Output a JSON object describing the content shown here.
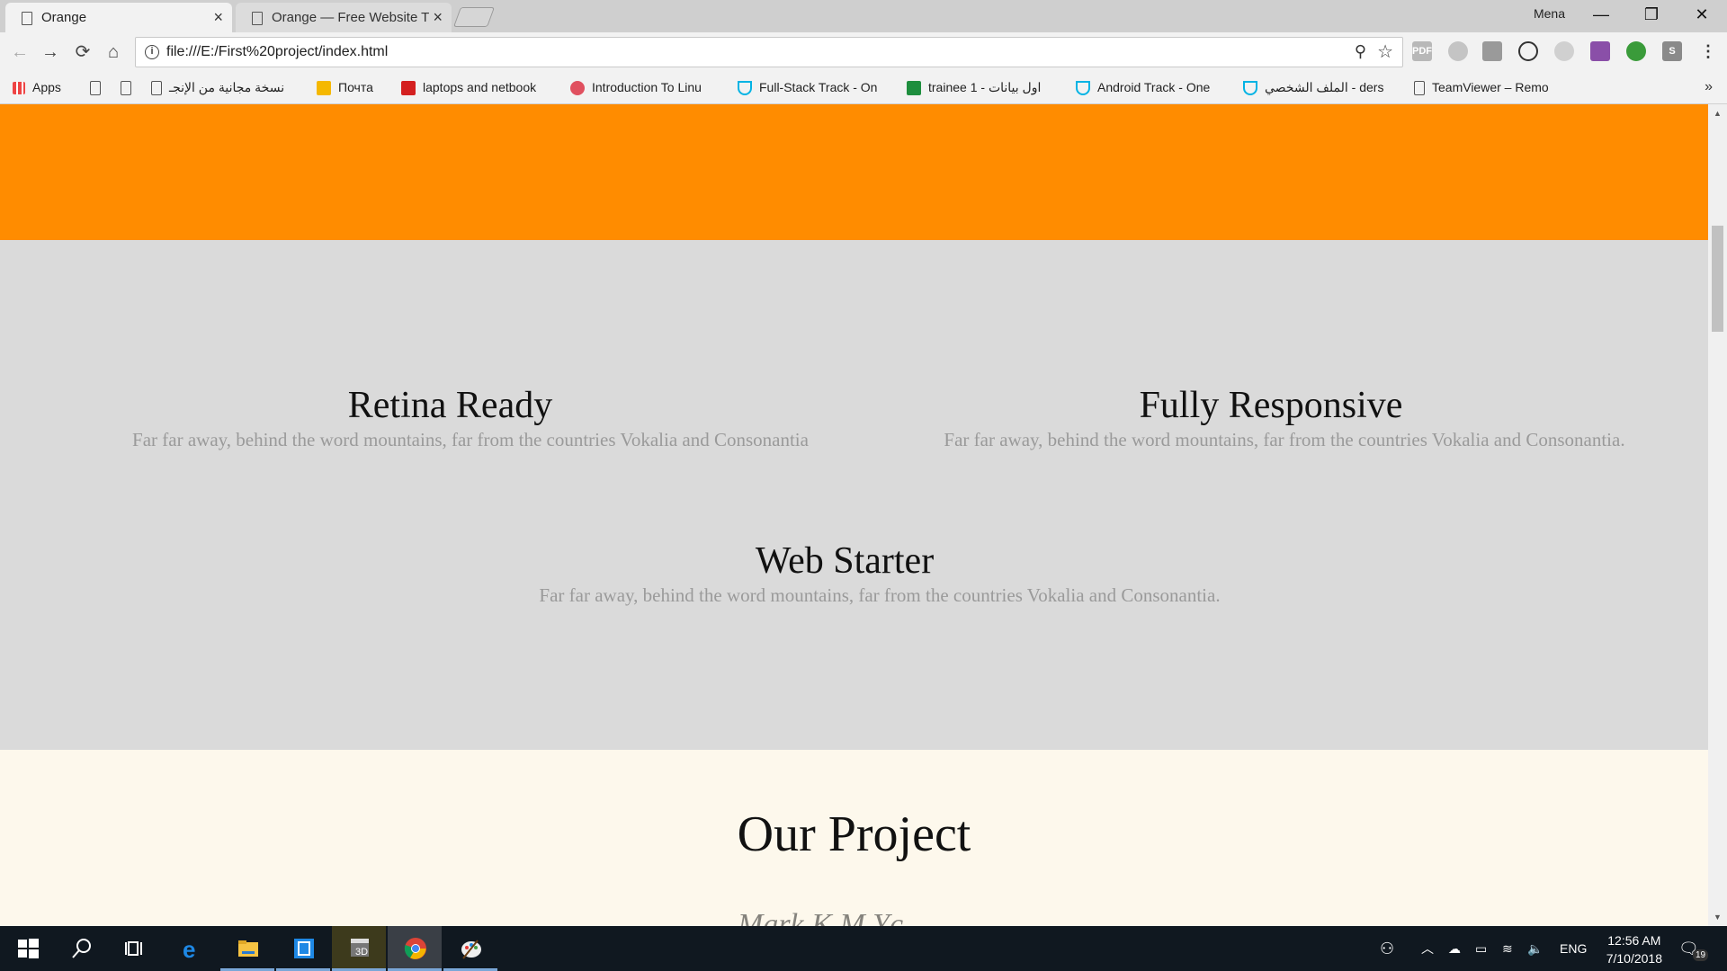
{
  "browser": {
    "tabs": [
      {
        "title": "Orange",
        "active": true
      },
      {
        "title": "Orange — Free Website T",
        "active": false
      }
    ],
    "profile_name": "Mena",
    "window_controls": {
      "minimize": "—",
      "restore": "❐",
      "close": "✕"
    },
    "url": "file:///E:/First%20project/index.html",
    "nav": {
      "back": "←",
      "forward": "→",
      "reload": "⟳",
      "home": "⌂"
    },
    "extensions": [
      "PDF",
      "",
      "",
      "",
      "",
      "",
      "",
      "S"
    ],
    "bookmarks": [
      {
        "label": "Apps",
        "icon": "apps-grid-icon"
      },
      {
        "label": "",
        "icon": "page-icon"
      },
      {
        "label": "",
        "icon": "page-icon"
      },
      {
        "label": "نسخة مجانية من الإنجـ",
        "icon": "page-icon"
      },
      {
        "label": "Почта",
        "icon": "mail-icon"
      },
      {
        "label": "laptops and netbook",
        "icon": "l-icon"
      },
      {
        "label": "Introduction To Linu",
        "icon": "udemy-icon"
      },
      {
        "label": "Full-Stack Track - On",
        "icon": "udacity-icon"
      },
      {
        "label": "trainee 1 - اول بيانات",
        "icon": "sheets-icon"
      },
      {
        "label": "Android Track - One",
        "icon": "udacity-icon"
      },
      {
        "label": "الملف الشخصي - ders",
        "icon": "udacity-icon"
      },
      {
        "label": "TeamViewer – Remo",
        "icon": "page-icon"
      }
    ],
    "bookmarks_more": "»"
  },
  "page": {
    "features": [
      {
        "title": "Retina Ready",
        "text": "Far far away, behind the word mountains, far from the countries Vokalia and Consonantia"
      },
      {
        "title": "Fully Responsive",
        "text": "Far far away, behind the word mountains, far from the countries Vokalia and Consonantia."
      },
      {
        "title": "Web Starter",
        "text": "Far far away, behind the word mountains, far from the countries Vokalia and Consonantia."
      }
    ],
    "project_heading": "Our Project",
    "watermark": "Mark K.M.Yc",
    "colors": {
      "orange": "#ff8c00",
      "grey_section": "#dadada",
      "cream_section": "#fdf8ec"
    }
  },
  "taskbar": {
    "apps": [
      "start-icon",
      "search-icon",
      "task-view-icon",
      "edge-icon",
      "file-explorer-icon",
      "app-icon",
      "media-app-icon",
      "chrome-icon",
      "paint-icon"
    ],
    "language": "ENG",
    "time": "12:56 AM",
    "date": "7/10/2018",
    "notification_count": "19"
  }
}
